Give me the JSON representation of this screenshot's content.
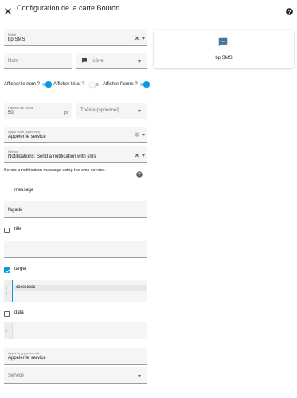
{
  "header": {
    "title": "Configuration de la carte Bouton"
  },
  "form": {
    "entity": {
      "label": "Entité",
      "value": "bp SMS"
    },
    "name": {
      "placeholder": "Nom"
    },
    "icon": {
      "placeholder": "Icône"
    },
    "show_name": {
      "label": "Afficher le nom ?",
      "on": true
    },
    "show_state": {
      "label": "Afficher l'état ?",
      "on": false
    },
    "show_icon": {
      "label": "Afficher l'icône ?",
      "on": true
    },
    "icon_height": {
      "label": "Hauteur de l'icône",
      "value": "50",
      "unit": "px"
    },
    "theme": {
      "placeholder": "Thème (optionnel)"
    },
    "tap_action": {
      "label": "Appui court (optionnel)",
      "value": "Appeler le service"
    },
    "service": {
      "label": "Service",
      "value": "Notifications: Send a notification with sms"
    },
    "service_description": "Sends a notification message using the sms service.",
    "message": {
      "label": "message"
    },
    "message_field": {
      "value": "fagade"
    },
    "title": {
      "label": "title",
      "checked": false
    },
    "target": {
      "label": "target",
      "checked": true,
      "lines": [
        "1",
        "2"
      ],
      "code": "600000000"
    },
    "data": {
      "label": "data",
      "checked": false,
      "lines": [
        "1"
      ]
    },
    "hold_action": {
      "label": "Appui long (optionnel)",
      "value": "Appeler le service"
    },
    "hold_service": {
      "placeholder": "Service"
    }
  },
  "preview": {
    "name": "bp SMS",
    "icon": "message-processing-icon"
  },
  "colors": {
    "accent": "#039be5",
    "icon_blue": "#44739e",
    "field_bg": "#f5f5f5"
  }
}
